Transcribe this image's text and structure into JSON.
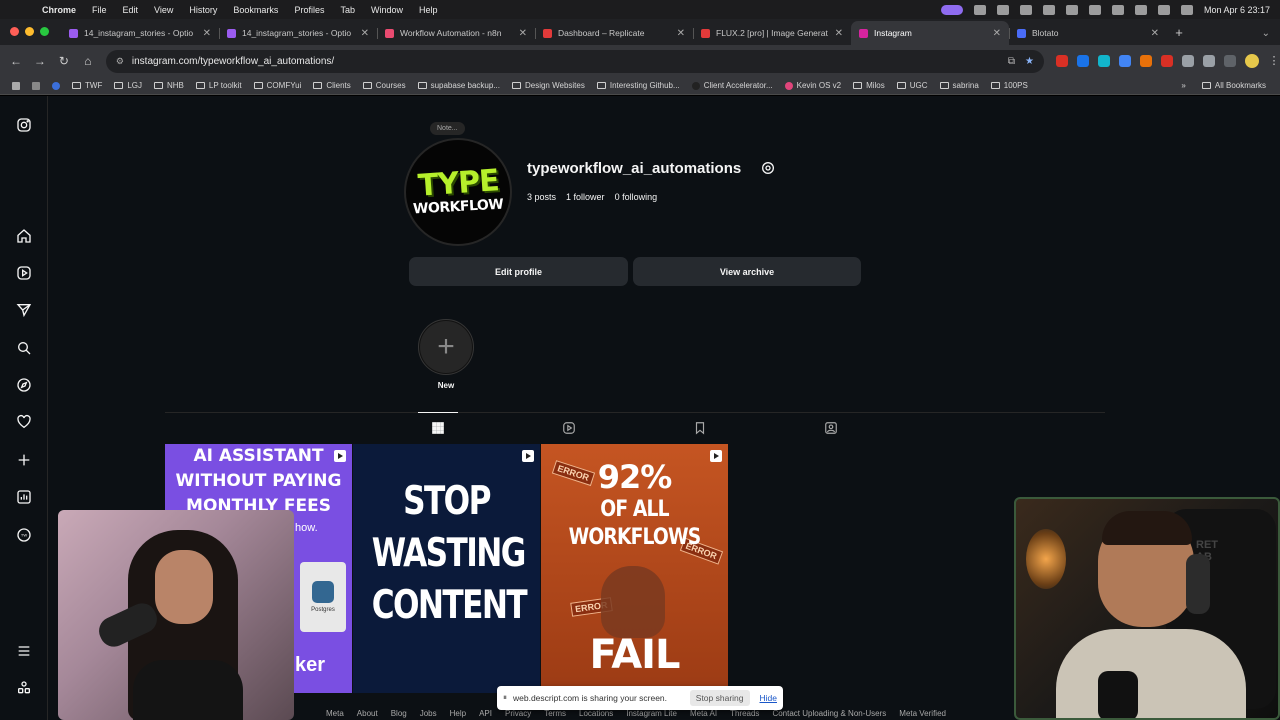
{
  "menubar": {
    "app": "Chrome",
    "items": [
      "File",
      "Edit",
      "View",
      "History",
      "Bookmarks",
      "Profiles",
      "Tab",
      "Window",
      "Help"
    ],
    "clock": "Mon Apr 6  23:17"
  },
  "tabs": [
    {
      "label": "14_instagram_stories - Optio",
      "color": "#9b5cf0"
    },
    {
      "label": "14_instagram_stories - Optio",
      "color": "#9b5cf0"
    },
    {
      "label": "Workflow Automation - n8n",
      "color": "#ea4b71"
    },
    {
      "label": "Dashboard – Replicate",
      "color": "#e23a3a"
    },
    {
      "label": "FLUX.2 [pro] | Image Generat",
      "color": "#e23a3a"
    },
    {
      "label": "Instagram",
      "color": "#d6249f",
      "active": true
    },
    {
      "label": "Blotato",
      "color": "#4a6cf7"
    }
  ],
  "toolbar": {
    "url": "instagram.com/typeworkflow_ai_automations/"
  },
  "bookmarks": [
    {
      "label": "TWF",
      "type": "folder"
    },
    {
      "label": "LGJ",
      "type": "folder"
    },
    {
      "label": "NHB",
      "type": "folder"
    },
    {
      "label": "LP toolkit",
      "type": "folder"
    },
    {
      "label": "COMFYui",
      "type": "folder"
    },
    {
      "label": "Clients",
      "type": "folder"
    },
    {
      "label": "Courses",
      "type": "folder"
    },
    {
      "label": "supabase backup...",
      "type": "folder"
    },
    {
      "label": "Design Websites",
      "type": "folder"
    },
    {
      "label": "Interesting Github...",
      "type": "folder"
    },
    {
      "label": "Client Accelerator...",
      "type": "link"
    },
    {
      "label": "Kevin OS v2",
      "type": "link"
    },
    {
      "label": "Milos",
      "type": "folder"
    },
    {
      "label": "UGC",
      "type": "folder"
    },
    {
      "label": "sabrina",
      "type": "folder"
    },
    {
      "label": "100PS",
      "type": "folder"
    }
  ],
  "bookmarks_all": "All Bookmarks",
  "profile": {
    "note": "Note...",
    "avatar_line1": "TYPE",
    "avatar_line2": "WORKFLOW",
    "username": "typeworkflow_ai_automations",
    "posts": "3 posts",
    "followers": "1 follower",
    "following": "0 following",
    "edit_button": "Edit profile",
    "archive_button": "View archive",
    "highlight_label": "New",
    "highlight_plus": "+"
  },
  "posts": [
    {
      "lines": [
        "AI ASSISTANT",
        "WITHOUT PAYING",
        "MONTHLY FEES"
      ],
      "howto": "how.",
      "db_label": "Postgres",
      "bottom": "ker"
    },
    {
      "lines": [
        "STOP",
        "WASTING",
        "CONTENT"
      ]
    },
    {
      "pct": "92%",
      "mid": [
        "OF ALL",
        "WORKFLOWS"
      ],
      "fail": "FAIL",
      "err_labels": [
        "ERROR",
        "ERROR",
        "ERROR"
      ]
    }
  ],
  "footer": [
    "Meta",
    "About",
    "Blog",
    "Jobs",
    "Help",
    "API",
    "Privacy",
    "Terms",
    "Locations",
    "Instagram Lite",
    "Meta AI",
    "Threads",
    "Contact Uploading & Non-Users",
    "Meta Verified"
  ],
  "sharebar": {
    "message": "web.descript.com is sharing your screen.",
    "stop": "Stop sharing",
    "hide": "Hide"
  },
  "cam_right": {
    "chair_text": "RET\nAB"
  }
}
